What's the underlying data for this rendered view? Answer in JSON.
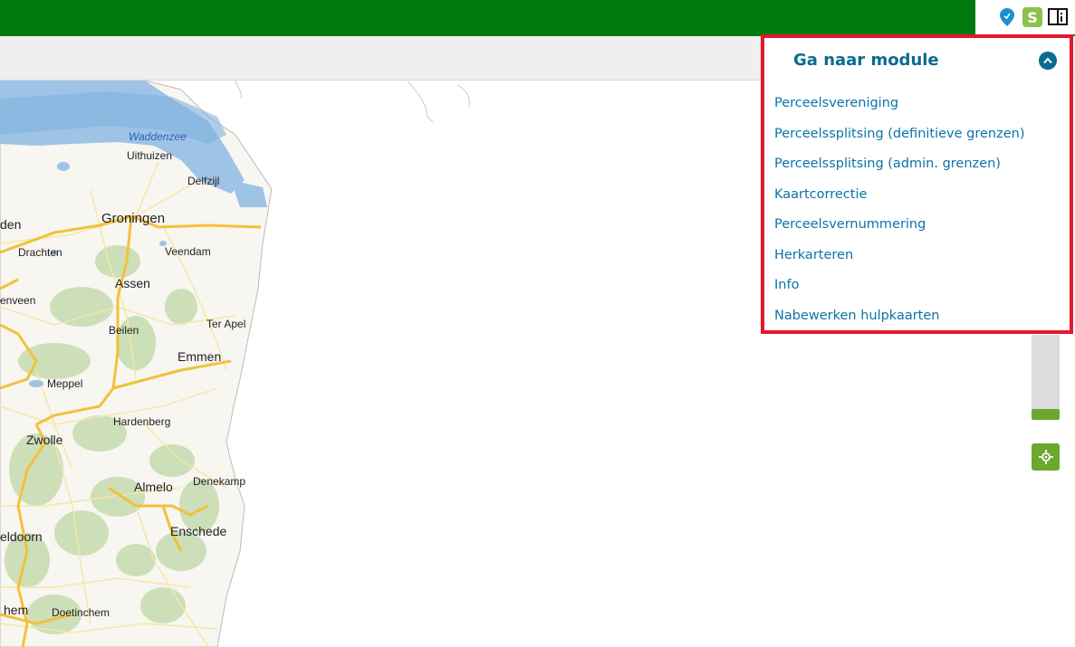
{
  "topbar": {
    "icons": [
      "location-pin-icon",
      "s-app-icon",
      "book-info-icon"
    ],
    "s_icon_text": "S",
    "color": "#007a0f"
  },
  "module_panel": {
    "title": "Ga naar module",
    "items": [
      {
        "label": "Perceelsvereniging"
      },
      {
        "label": "Perceelssplitsing (definitieve grenzen)"
      },
      {
        "label": "Perceelssplitsing (admin. grenzen)"
      },
      {
        "label": "Kaartcorrectie"
      },
      {
        "label": "Perceelsvernummering"
      },
      {
        "label": "Herkarteren"
      },
      {
        "label": "Info"
      },
      {
        "label": "Nabewerken hulpkaarten"
      }
    ],
    "border_color": "#e3192a",
    "link_color": "#0b73a8"
  },
  "map": {
    "water_label": "Waddenzee",
    "places": [
      {
        "name": "Uithuizen"
      },
      {
        "name": "Delfzijl"
      },
      {
        "name": "den"
      },
      {
        "name": "Groningen"
      },
      {
        "name": "Drachten"
      },
      {
        "name": "Veendam"
      },
      {
        "name": "Assen"
      },
      {
        "name": "enveen"
      },
      {
        "name": "Beilen"
      },
      {
        "name": "Ter Apel"
      },
      {
        "name": "Emmen"
      },
      {
        "name": "Meppel"
      },
      {
        "name": "Hardenberg"
      },
      {
        "name": "Zwolle"
      },
      {
        "name": "Almelo"
      },
      {
        "name": "Denekamp"
      },
      {
        "name": "Enschede"
      },
      {
        "name": "eldoorn"
      },
      {
        "name": "hem"
      },
      {
        "name": "Doetinchem"
      }
    ]
  },
  "controls": {
    "zoom_bar": "zoom-slider",
    "locate_icon": "crosshair-icon",
    "accent": "#6aa82e"
  }
}
